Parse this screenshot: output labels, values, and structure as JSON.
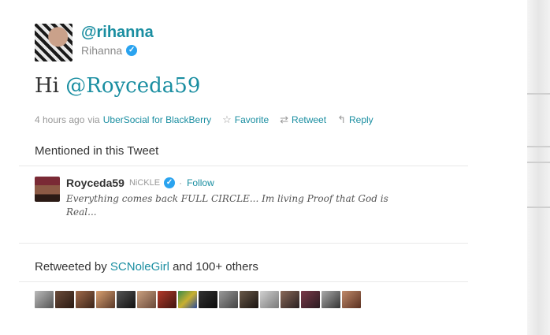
{
  "tweet": {
    "screen_name": "@rihanna",
    "real_name": "Rihanna",
    "text_prefix": "Hi ",
    "text_mention": "@Royceda59",
    "timestamp": "4 hours ago",
    "via_label": "via",
    "source": "UberSocial for BlackBerry",
    "actions": {
      "favorite": "Favorite",
      "retweet": "Retweet",
      "reply": "Reply"
    }
  },
  "mentioned": {
    "title": "Mentioned in this Tweet",
    "user": {
      "screen_name": "Royceda59",
      "name": "NiCKLE",
      "follow_label": "Follow",
      "bio": "Everything comes back FULL CIRCLE... Im living Proof that God is Real..."
    }
  },
  "retweeted": {
    "prefix": "Retweeted by",
    "user": "SCNoleGirl",
    "suffix": "and 100+ others"
  },
  "icons": {
    "verified": "verified-check-icon",
    "favorite": "star-icon",
    "retweet": "retweet-icon",
    "reply": "reply-arrow-icon"
  },
  "colors": {
    "link": "#1a8ea1",
    "verified": "#2aa3ef"
  }
}
